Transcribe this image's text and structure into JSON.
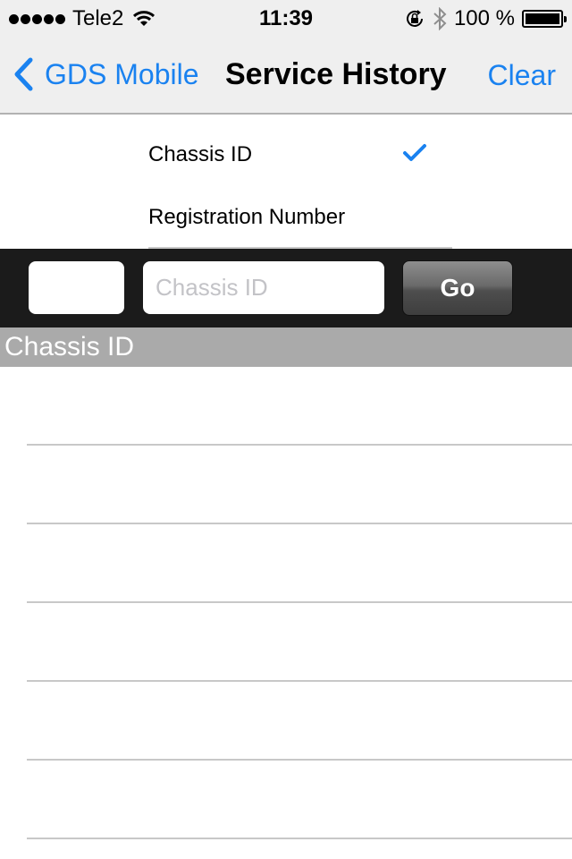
{
  "status_bar": {
    "signal_dots": 5,
    "carrier": "Tele2",
    "wifi_icon": "wifi-icon",
    "time": "11:39",
    "rotation_lock_icon": "rotation-lock-icon",
    "bluetooth_icon": "bluetooth-icon",
    "battery_percent_label": "100 %",
    "battery_level": 1.0
  },
  "nav_bar": {
    "back_label": "GDS Mobile",
    "title": "Service History",
    "clear_label": "Clear",
    "accent_color": "#1a82f0"
  },
  "picker": {
    "options": [
      {
        "label": "Chassis ID",
        "selected": true
      },
      {
        "label": "Registration Number",
        "selected": false
      }
    ]
  },
  "search": {
    "prefix_value": "",
    "id_value": "",
    "id_placeholder": "Chassis ID",
    "go_label": "Go"
  },
  "results": {
    "section_header": "Chassis ID",
    "rows": [
      "",
      "",
      "",
      "",
      "",
      ""
    ]
  }
}
